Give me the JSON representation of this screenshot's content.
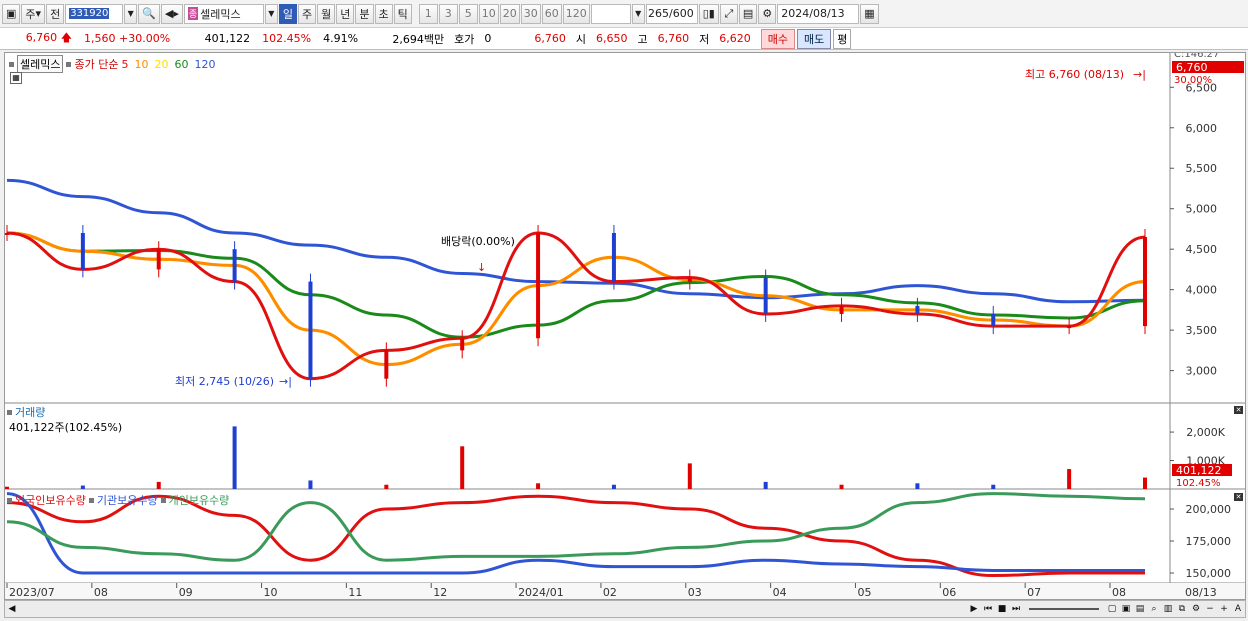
{
  "toolbar": {
    "market": "주",
    "prev_label": "전",
    "code": "331920",
    "name_tag": "종",
    "name": "셀레믹스",
    "periods": [
      "일",
      "주",
      "월",
      "년",
      "분",
      "초",
      "틱"
    ],
    "active_period": "일",
    "intervals": [
      "1",
      "3",
      "5",
      "10",
      "20",
      "30",
      "60",
      "120"
    ],
    "count": "265",
    "count_max": "/600",
    "date": "2024/08/13"
  },
  "quote": {
    "price": "6,760",
    "change": "1,560",
    "change_pct": "+30.00%",
    "volume": "401,122",
    "volume_ratio": "102.45%",
    "turnover": "4.91%",
    "amount": "2,694백만",
    "hoga_label": "호가",
    "hoga_value": "0",
    "hoga_price": "6,760",
    "open_label": "시",
    "open": "6,650",
    "high_label": "고",
    "high": "6,760",
    "low_label": "저",
    "low": "6,620",
    "buy_label": "매수",
    "sell_label": "매도",
    "avg_label": "평"
  },
  "price_panel": {
    "stock_chip": "셀레믹스",
    "ma_title": "종가 단순",
    "ma_periods": [
      "5",
      "10",
      "20",
      "60",
      "120"
    ],
    "ma_colors": [
      "#e01010",
      "#ff8c00",
      "#ffe000",
      "#1a8a1a",
      "#2f55d4"
    ],
    "high_annotation": "최고 6,760 (08/13)",
    "low_annotation": "최저 2,745 (10/26)",
    "dividend_annotation": "배당락(0.00%)",
    "y_ticks": [
      "6,500",
      "6,000",
      "5,500",
      "5,000",
      "4,500",
      "4,000",
      "3,500",
      "3,000"
    ],
    "current_price_tag": "6,760",
    "pct_tag": "30.00%",
    "top_tag": "C:146.27"
  },
  "volume_panel": {
    "title": "거래량",
    "value_label": "401,122주(102.45%)",
    "y_ticks": [
      "2,000K",
      "1,000K"
    ],
    "current_tag": "401,122",
    "pct_tag": "102.45%"
  },
  "holding_panel": {
    "series": [
      "외국인보유수량",
      "기관보유수량",
      "개인보유수량"
    ],
    "series_colors": [
      "#e01010",
      "#2f55d4",
      "#3a9a5a"
    ],
    "y_ticks": [
      "200,000",
      "175,000",
      "150,000"
    ]
  },
  "x_axis": {
    "labels": [
      "2023/07",
      "08",
      "09",
      "10",
      "11",
      "12",
      "2024/01",
      "02",
      "03",
      "04",
      "05",
      "06",
      "07",
      "08"
    ],
    "right_date": "08/13"
  },
  "chart_data": {
    "type": "line",
    "title": "셀레믹스",
    "x": [
      "2023/07",
      "2023/08",
      "2023/09",
      "2023/10",
      "2023/10/26",
      "2023/11",
      "2023/12",
      "2024/01",
      "2024/02",
      "2024/03",
      "2024/04",
      "2024/05",
      "2024/06",
      "2024/07",
      "2024/08",
      "2024/08/13"
    ],
    "series": [
      {
        "name": "5",
        "values": [
          4700,
          4250,
          4500,
          4100,
          2900,
          3250,
          3400,
          4700,
          4100,
          4150,
          3700,
          3800,
          3700,
          3550,
          3550,
          4650
        ]
      },
      {
        "name": "120",
        "values": [
          5350,
          5150,
          4950,
          4700,
          4550,
          4400,
          4200,
          4100,
          4080,
          3950,
          3900,
          3950,
          4050,
          3950,
          3850,
          3870
        ]
      }
    ],
    "volume_bars": [
      80000,
      120000,
      250000,
      2200000,
      300000,
      150000,
      1500000,
      200000,
      150000,
      900000,
      250000,
      150000,
      200000,
      150000,
      700000,
      401122
    ],
    "ylim": [
      2600,
      6800
    ],
    "high": {
      "value": 6760,
      "date": "08/13"
    },
    "low": {
      "value": 2745,
      "date": "10/26"
    }
  }
}
